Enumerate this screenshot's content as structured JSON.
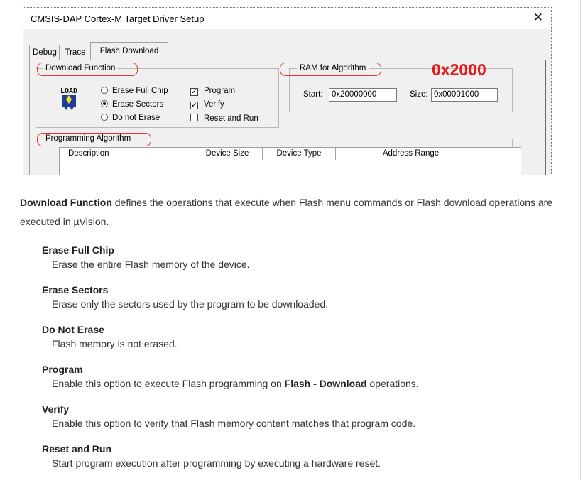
{
  "dialog": {
    "title": "CMSIS-DAP Cortex-M Target Driver Setup",
    "close_glyph": "✕",
    "tabs": [
      {
        "label": "Debug"
      },
      {
        "label": "Trace"
      },
      {
        "label": "Flash Download",
        "active": true
      }
    ],
    "download_function": {
      "legend": "Download Function",
      "icon_text": "LOAD",
      "radios": [
        {
          "label": "Erase Full Chip",
          "checked": false
        },
        {
          "label": "Erase Sectors",
          "checked": true
        },
        {
          "label": "Do not Erase",
          "checked": false
        }
      ],
      "checkboxes": [
        {
          "label": "Program",
          "checked": true
        },
        {
          "label": "Verify",
          "checked": true
        },
        {
          "label": "Reset and Run",
          "checked": false
        }
      ]
    },
    "ram_for_algorithm": {
      "legend": "RAM for Algorithm",
      "annotation": "0x2000",
      "start_label": "Start:",
      "start_value": "0x20000000",
      "size_label": "Size:",
      "size_value": "0x00001000"
    },
    "programming_algorithm": {
      "legend": "Programming Algorithm",
      "columns": [
        "Description",
        "Device Size",
        "Device Type",
        "Address Range"
      ]
    },
    "annotation_color": "#e8372e"
  },
  "doc": {
    "intro_bold": "Download Function",
    "intro_rest": " defines the operations that execute when Flash menu commands or Flash download operations are executed in µVision.",
    "terms": [
      {
        "title": "Erase Full Chip",
        "desc": "Erase the entire Flash memory of the device."
      },
      {
        "title": "Erase Sectors",
        "desc": "Erase only the sectors used by the program to be downloaded."
      },
      {
        "title": "Do Not Erase",
        "desc": "Flash memory is not erased."
      },
      {
        "title": "Program",
        "desc_pre": "Enable this option to execute Flash programming on ",
        "desc_bold": "Flash - Download",
        "desc_post": " operations."
      },
      {
        "title": "Verify",
        "desc": "Enable this option to verify that Flash memory content matches that program code."
      },
      {
        "title": "Reset and Run",
        "desc": "Start program execution after programming by executing a hardware reset."
      }
    ]
  }
}
